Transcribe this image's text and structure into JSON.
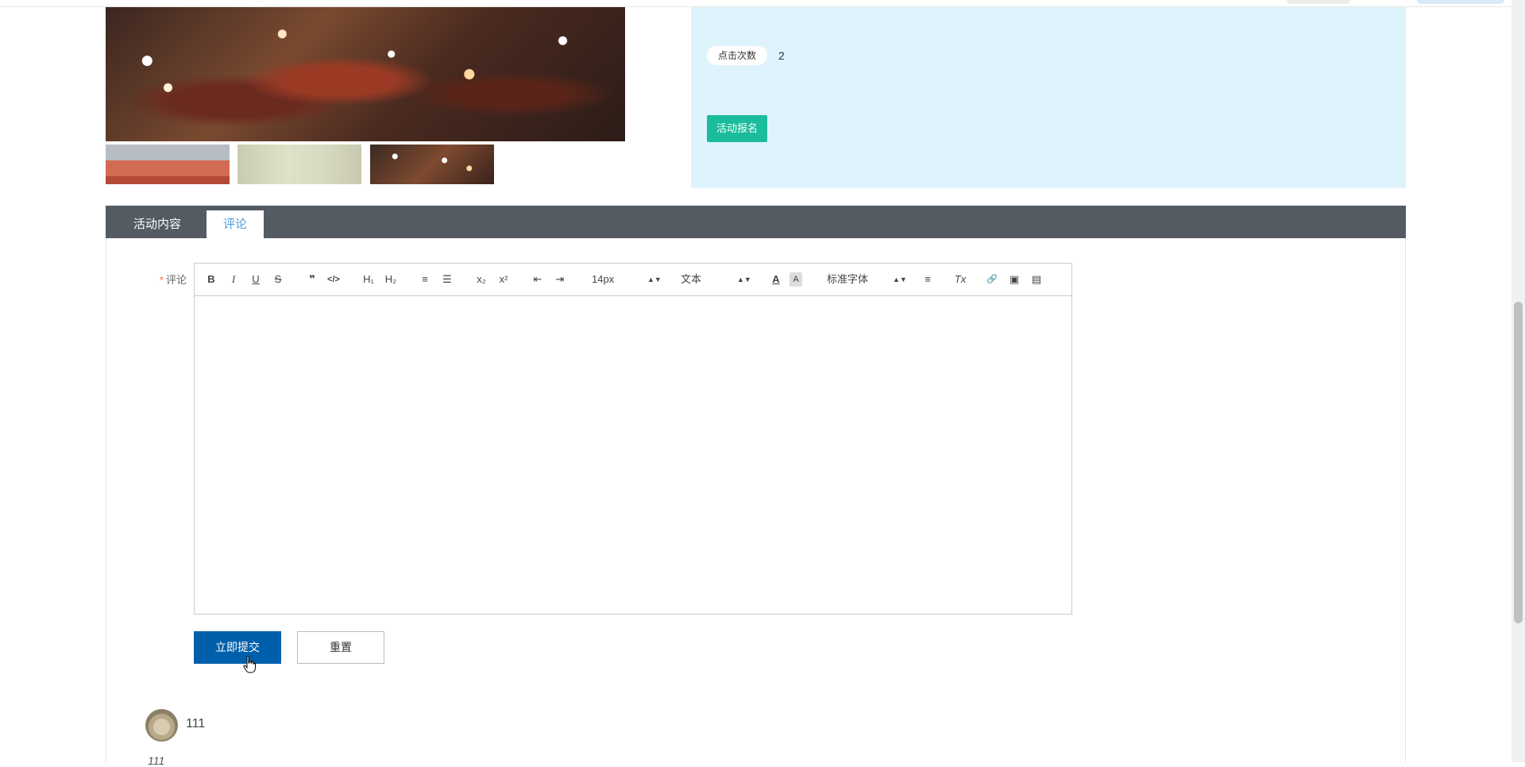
{
  "info": {
    "click_count_label": "点击次数",
    "click_count_value": "2",
    "signup_label": "活动报名"
  },
  "tabs": [
    {
      "label": "活动内容",
      "active": false
    },
    {
      "label": "评论",
      "active": true
    }
  ],
  "form": {
    "comment_label": "评论",
    "required_mark": "*"
  },
  "editor": {
    "toolbar": {
      "bold": "B",
      "italic": "I",
      "underline": "U",
      "strike": "S",
      "quote": "❞",
      "code": "</>",
      "h1": "H₁",
      "h2": "H₂",
      "ordered_list": "≡",
      "bullet_list": "☰",
      "subscript": "x₂",
      "superscript": "x²",
      "outdent": "⇤",
      "indent": "⇥",
      "font_size": "14px",
      "block_type": "文本",
      "font_family": "标准字体",
      "font_color": "A",
      "background_color": "A",
      "align": "≡",
      "clean": "Tx",
      "link": "🔗",
      "image": "▣",
      "video": "▤"
    }
  },
  "buttons": {
    "submit": "立即提交",
    "reset": "重置"
  },
  "comments": [
    {
      "username": "111",
      "text_peek": "111"
    }
  ],
  "colors": {
    "accent_blue": "#005fab",
    "signup_green": "#1abc9c",
    "tab_bar": "#545b62",
    "info_panel": "#dff3fd",
    "active_tab_text": "#4a9de0"
  }
}
